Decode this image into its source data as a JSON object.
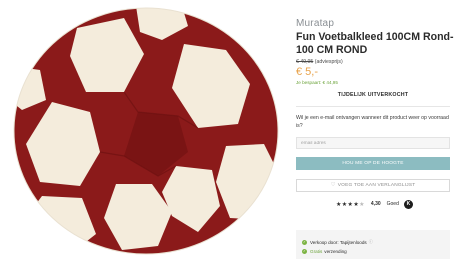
{
  "product": {
    "brand": "Muratap",
    "title": "Fun Voetbalkleed 100CM Rond- 100 CM ROND",
    "old_price": "€ 49,95",
    "old_price_note": "(adviesprijs)",
    "price": "€ 5,-",
    "savings": "Je bespaart: € 44,95",
    "image_alt": "Rond voetbalkleed"
  },
  "stock": {
    "status": "TIJDELIJK UITVERKOCHT"
  },
  "notify": {
    "question": "Wil je een e-mail ontvangen wanneer dit product weer op voorraad is?",
    "email_placeholder": "email adres",
    "button_label": "HOU ME OP DE HOOGTE"
  },
  "wishlist": {
    "button_label": "VOEG TOE AAN VERLANGLIJST"
  },
  "rating": {
    "stars_full": "★★★★",
    "stars_partial": "★",
    "score": "4,30",
    "label": "Goed",
    "badge": "K"
  },
  "usps": {
    "sold_by_prefix": "Verkoop door:",
    "sold_by_name": "Tapijtenloods",
    "shipping_free": "Gratis",
    "shipping_label": "verzending"
  },
  "colors": {
    "accent_price": "#e8a24a",
    "savings_green": "#6ba33a",
    "notify_button": "#8cbcc1",
    "rug_red": "#8b1a1a",
    "rug_cream": "#f4ecdc"
  }
}
